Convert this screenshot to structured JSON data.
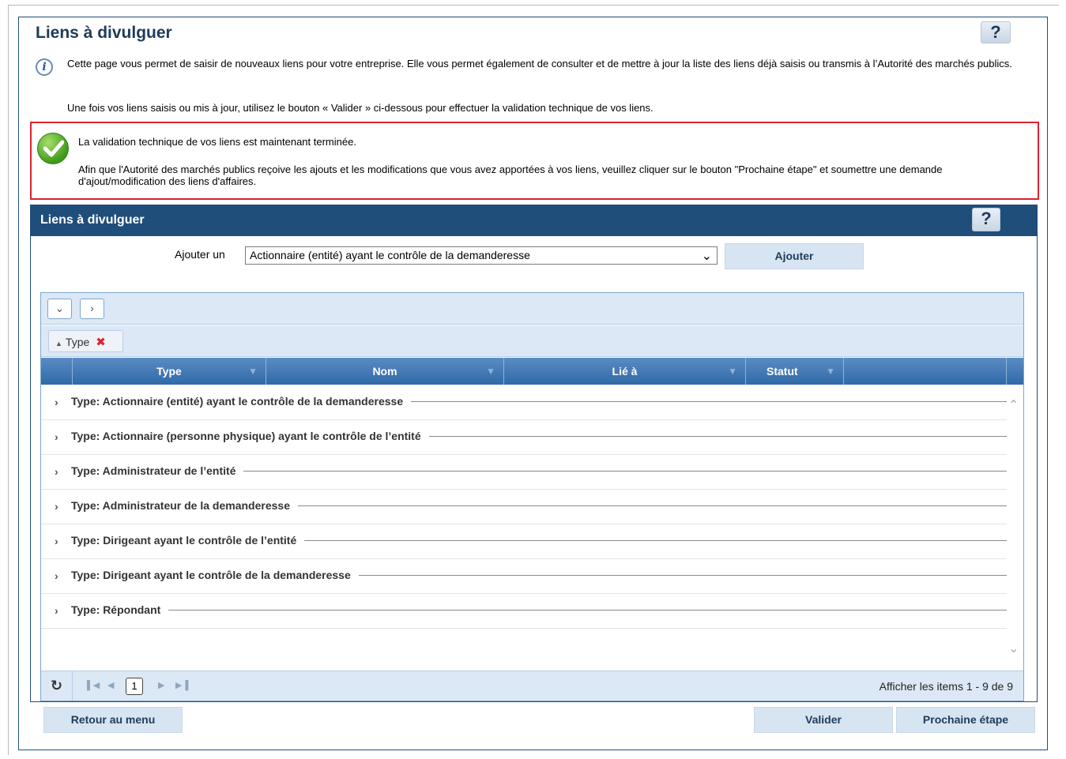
{
  "page": {
    "title": "Liens à divulguer",
    "help": "?",
    "intro_1": "Cette page vous permet de saisir de nouveaux liens pour votre entreprise. Elle vous permet également de consulter et de mettre à jour la liste des liens déjà saisis ou transmis à l’Autorité des marchés publics.",
    "intro_2": "Une fois vos liens saisis ou mis à jour, utilisez le bouton « Valider » ci-dessous pour effectuer la validation technique de vos liens."
  },
  "success": {
    "line1": "La validation technique de vos liens est maintenant terminée.",
    "line2": "Afin que l'Autorité des marchés publics reçoive les ajouts et les modifications que vous avez apportées à vos liens, veuillez cliquer sur le bouton \"Prochaine étape\" et soumettre une demande d'ajout/modification des liens d'affaires."
  },
  "panel": {
    "title": "Liens à divulguer",
    "help": "?",
    "add_label": "Ajouter un",
    "add_select_value": "Actionnaire (entité) ayant le contrôle de la demanderesse",
    "add_button": "Ajouter"
  },
  "grid": {
    "group_chip": "Type",
    "columns": [
      "Type",
      "Nom",
      "Lié à",
      "Statut"
    ],
    "groups": [
      "Type: Actionnaire (entité) ayant le contrôle de la demanderesse",
      "Type: Actionnaire (personne physique) ayant le contrôle de l’entité",
      "Type: Administrateur de l’entité",
      "Type: Administrateur de la demanderesse",
      "Type: Dirigeant ayant le contrôle de l’entité",
      "Type: Dirigeant ayant le contrôle de la demanderesse",
      "Type: Répondant"
    ],
    "pager": {
      "current_page": "1",
      "info": "Afficher les items 1 - 9 de 9"
    }
  },
  "footer": {
    "back": "Retour au menu",
    "validate": "Valider",
    "next": "Prochaine étape"
  },
  "colors": {
    "primary": "#1f4e7a",
    "success_border": "#d9232e",
    "button_bg": "#d7e4f2"
  }
}
